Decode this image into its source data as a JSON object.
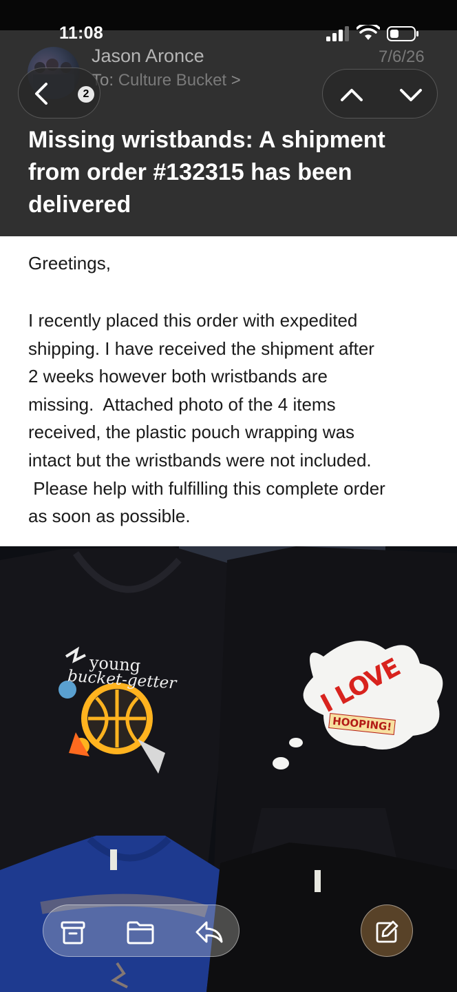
{
  "status_bar": {
    "time": "11:08"
  },
  "header": {
    "sender": "Jason Aronce",
    "recipient_prefix": "To: ",
    "recipient": "Culture Bucket",
    "recipient_chevron": ">",
    "date": "7/6/26",
    "unread_count": "2",
    "subject": "Missing wristbands: A shipment from order #132315 has been delivered"
  },
  "message": {
    "greeting": "Greetings,",
    "paragraph_lines": [
      "I recently placed this order with expedited",
      "shipping. I have received the shipment after",
      "2 weeks however both wristbands are",
      "missing.  Attached photo of the 4 items",
      "received, the plastic pouch wrapping was",
      "intact but the wristbands were not included.",
      " Please help with fulfilling this complete order",
      "as soon as possible."
    ]
  },
  "attachment": {
    "shirt_text_line1": "young",
    "shirt_text_line2": "bucket-getter",
    "sticker_text": "I LOVE",
    "sticker_subtext": "HOOPING!"
  },
  "icons": {
    "back": "chevron-left-icon",
    "up": "chevron-up-icon",
    "down": "chevron-down-icon",
    "archive": "archive-icon",
    "move": "folder-icon",
    "reply": "reply-icon",
    "compose": "compose-icon"
  },
  "colors": {
    "header_bg": "#303030",
    "body_bg": "#ffffff",
    "sticker_red": "#d8231e"
  }
}
